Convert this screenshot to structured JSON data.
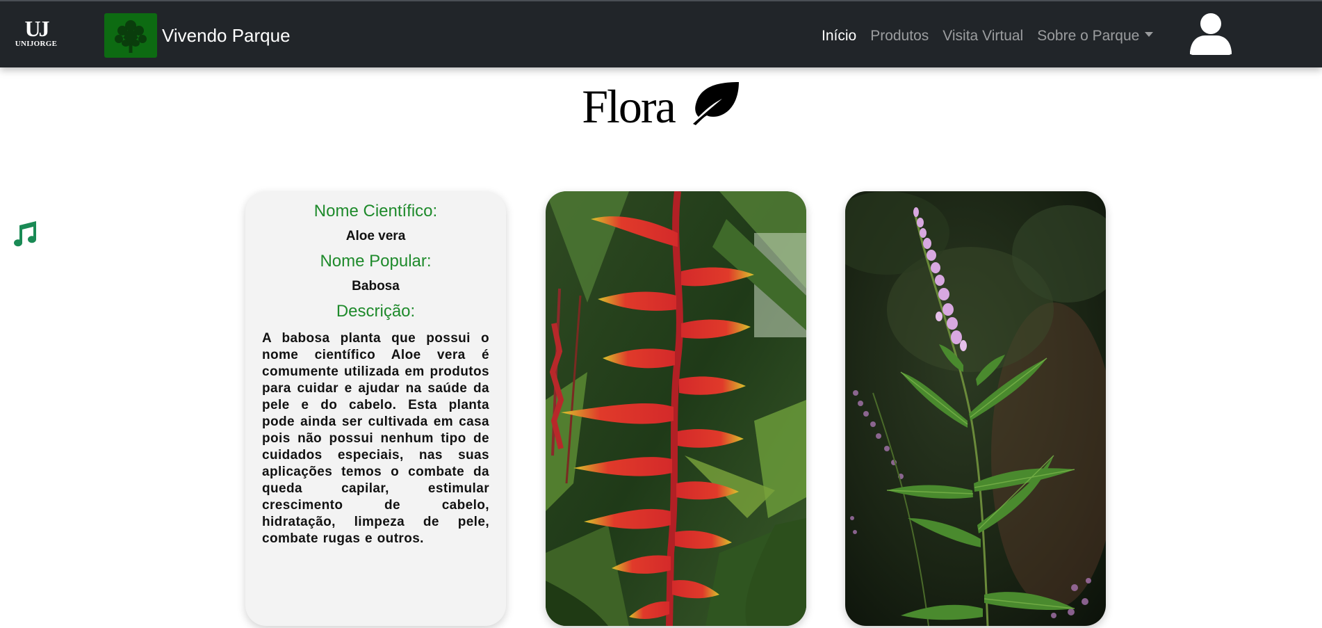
{
  "navbar": {
    "org_logo_mark": "UJ",
    "org_logo_name": "UNIJORGE",
    "brand_name": "Vivendo Parque",
    "links": [
      {
        "label": "Início",
        "active": true
      },
      {
        "label": "Produtos",
        "active": false
      },
      {
        "label": "Visita Virtual",
        "active": false
      },
      {
        "label": "Sobre o Parque",
        "active": false,
        "dropdown": true
      }
    ],
    "user_icon": "user-icon"
  },
  "page": {
    "title": "Flora",
    "title_icon": "leaf-icon",
    "music_icon": "music-note-icon"
  },
  "info_card": {
    "scientific_name_label": "Nome Científico:",
    "scientific_name": "Aloe vera",
    "popular_name_label": "Nome Popular:",
    "popular_name": "Babosa",
    "description_label": "Descrição:",
    "description": "A babosa planta que possui o nome científico Aloe vera é comumente utilizada em produtos para cuidar e ajudar na saúde da pele e do cabelo. Esta planta pode ainda ser cultivada em casa pois não possui nenhum tipo de cuidados especiais, nas suas aplicações temos o combate da queda capilar, estimular crescimento de cabelo, hidratação, limpeza de pele, combate rugas e outros."
  },
  "photos": [
    {
      "subject": "heliconia-photo"
    },
    {
      "subject": "purple-wildflower-photo"
    }
  ],
  "colors": {
    "navbar_bg": "#212529",
    "label_green": "#1e8a2b",
    "music_icon": "#1a8a55",
    "brand_logo_bg": "#0d6b12",
    "card_bg": "#f3f3f3"
  }
}
